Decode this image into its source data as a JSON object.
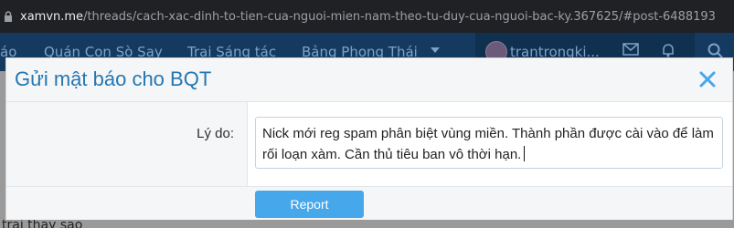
{
  "browser": {
    "url_domain": "xamvn.me",
    "url_path": "/threads/cach-xac-dinh-to-tien-cua-nguoi-mien-nam-theo-tu-duy-cua-nguoi-bac-ky.367625/#post-6488193"
  },
  "site_nav": {
    "items": [
      "áo",
      "Quán Con Sò Say",
      "Trại Sáng tác",
      "Bảng Phong Thái"
    ],
    "username": "trantrongki..."
  },
  "dialog": {
    "title": "Gửi mật báo cho BQT",
    "reason_label": "Lý do:",
    "reason_value": "Nick mới reg spam phân biệt vùng miền. Thành phần được cài vào để làm rối loạn xàm. Cần thủ tiêu ban vô thời hạn.",
    "submit_label": "Report"
  },
  "page_behind": {
    "text": "trai thay sao"
  },
  "colors": {
    "accent": "#2577b1",
    "button": "#47a7eb",
    "nav_bg": "#153a5f"
  }
}
